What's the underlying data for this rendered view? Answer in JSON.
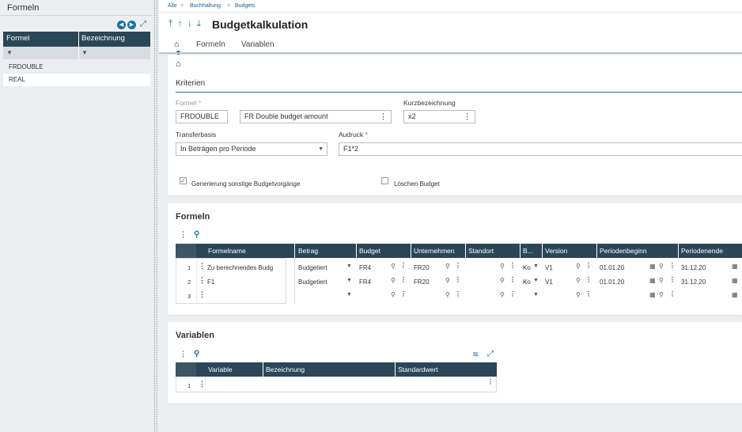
{
  "left_panel": {
    "title": "Formeln",
    "columns": [
      "Formel",
      "Bezeichnung"
    ],
    "rows": [
      "FRDOUBLE",
      "REAL"
    ]
  },
  "breadcrumb": [
    "Alle",
    "Buchhaltung",
    "Budgets"
  ],
  "page_title": "Budgetkalkulation",
  "tabs": [
    "Formeln",
    "Variablen"
  ],
  "kriterien": {
    "title": "Kriterien",
    "formel_label": "Formel",
    "formel_value": "FRDOUBLE",
    "formel_desc": "FR Double budget amount",
    "kurz_label": "Kurzbezeichnung",
    "kurz_value": "x2",
    "transfer_label": "Transferbasis",
    "transfer_value": "In Beträgen pro Periode",
    "ausdruck_label": "Audruck",
    "ausdruck_value": "F1*2",
    "gen_label": "Generierung sonstige Budgetvorgänge",
    "loeschen_label": "Löschen Budget"
  },
  "formeln_grid": {
    "title": "Formeln",
    "columns": [
      "Formelname",
      "Betrag",
      "Budget",
      "Unternehmen",
      "Standort",
      "B...",
      "Version",
      "Periodenbeginn",
      "Periodenende"
    ],
    "rows": [
      {
        "num": "1",
        "name": "Zu berechnendes Budg",
        "betrag": "Budgetiert",
        "budget": "FR4",
        "unternehmen": "FR20",
        "b": "Ko",
        "version": "V1",
        "beginn": "01.01.20",
        "ende": "31.12.20"
      },
      {
        "num": "2",
        "name": "F1",
        "betrag": "Budgetiert",
        "budget": "FR4",
        "unternehmen": "FR20",
        "b": "Ko",
        "version": "V1",
        "beginn": "01.01.20",
        "ende": "31.12.20"
      },
      {
        "num": "3",
        "name": "",
        "betrag": "",
        "budget": "",
        "unternehmen": "",
        "b": "",
        "version": "",
        "beginn": "",
        "ende": ""
      }
    ]
  },
  "variablen_grid": {
    "title": "Variablen",
    "columns": [
      "Variable",
      "Bezeichnung",
      "Standardwert"
    ],
    "rows": [
      {
        "num": "1"
      }
    ]
  }
}
